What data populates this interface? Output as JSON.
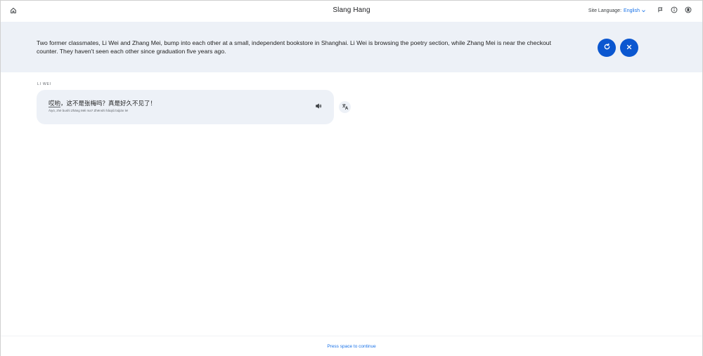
{
  "header": {
    "title": "Slang Hang",
    "site_language_label": "Site Language:",
    "site_language_value": "English",
    "icons": [
      "home-icon",
      "chevron-down-icon",
      "flag-icon",
      "info-icon",
      "account-icon"
    ]
  },
  "scenario": {
    "text": "Two former classmates, Li Wei and Zhang Mei, bump into each other at a small, independent bookstore in Shanghai. Li Wei is browsing the poetry section, while Zhang Mei is near the checkout counter. They haven't seen each other since graduation five years ago.",
    "buttons": [
      "refresh-icon",
      "close-icon"
    ]
  },
  "conversation": {
    "messages": [
      {
        "speaker": "LI WEI",
        "text_highlight": "哎哟",
        "text_rest": "，这不是张梅吗？真是好久不见了！",
        "pinyin": "Āiyō, zhè bushì Zhāng Méi ma? Zhēnshì hǎojiǔ bújiàn le!"
      }
    ]
  },
  "footer": {
    "hint": "Press space to continue"
  },
  "colors": {
    "accent": "#0b57d0",
    "link": "#1a73e8",
    "banner_bg": "#edf1f7"
  }
}
